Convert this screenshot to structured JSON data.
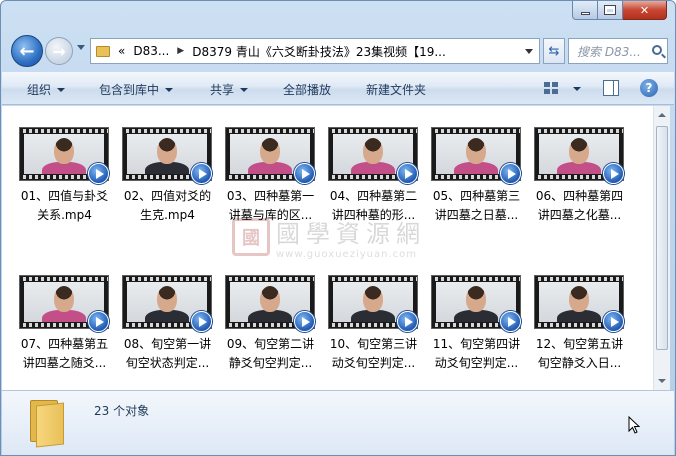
{
  "window": {
    "caption_min": "minimize",
    "caption_max": "maximize",
    "caption_close": "close"
  },
  "nav": {
    "address_prefix": "«",
    "address_crumb_1": "D83...",
    "address_sep": "▶",
    "address_crumb_2": "D8379 青山《六爻断卦技法》23集视频【19...",
    "search_placeholder": "搜索 D83...",
    "back_glyph": "←",
    "forward_glyph": "→",
    "refresh_glyph": "⇆"
  },
  "toolbar": {
    "organize": "组织",
    "include_in_library": "包含到库中",
    "share": "共享",
    "play_all": "全部播放",
    "new_folder": "新建文件夹",
    "help_glyph": "?"
  },
  "files": [
    {
      "label_1": "01、四值与卦爻",
      "label_2": "关系.mp4",
      "shirt": "pink"
    },
    {
      "label_1": "02、四值对爻的",
      "label_2": "生克.mp4",
      "shirt": "dark"
    },
    {
      "label_1": "03、四种墓第一",
      "label_2": "讲墓与库的区...",
      "shirt": "pink"
    },
    {
      "label_1": "04、四种墓第二",
      "label_2": "讲四种墓的形...",
      "shirt": "pink"
    },
    {
      "label_1": "05、四种墓第三",
      "label_2": "讲四墓之日墓...",
      "shirt": "pink"
    },
    {
      "label_1": "06、四种墓第四",
      "label_2": "讲四墓之化墓...",
      "shirt": "pink"
    },
    {
      "label_1": "07、四种墓第五",
      "label_2": "讲四墓之随爻...",
      "shirt": "pink"
    },
    {
      "label_1": "08、旬空第一讲",
      "label_2": "旬空状态判定...",
      "shirt": "dark"
    },
    {
      "label_1": "09、旬空第二讲",
      "label_2": "静爻旬空判定...",
      "shirt": "dark"
    },
    {
      "label_1": "10、旬空第三讲",
      "label_2": "动爻旬空判定...",
      "shirt": "dark"
    },
    {
      "label_1": "11、旬空第四讲",
      "label_2": "动爻旬空判定...",
      "shirt": "dark"
    },
    {
      "label_1": "12、旬空第五讲",
      "label_2": "旬空静爻入日...",
      "shirt": "dark"
    }
  ],
  "watermark": {
    "seal": "國",
    "cn": "國學資源網",
    "url": "www.guoxueziyuan.com"
  },
  "details": {
    "count": "23 个对象"
  }
}
